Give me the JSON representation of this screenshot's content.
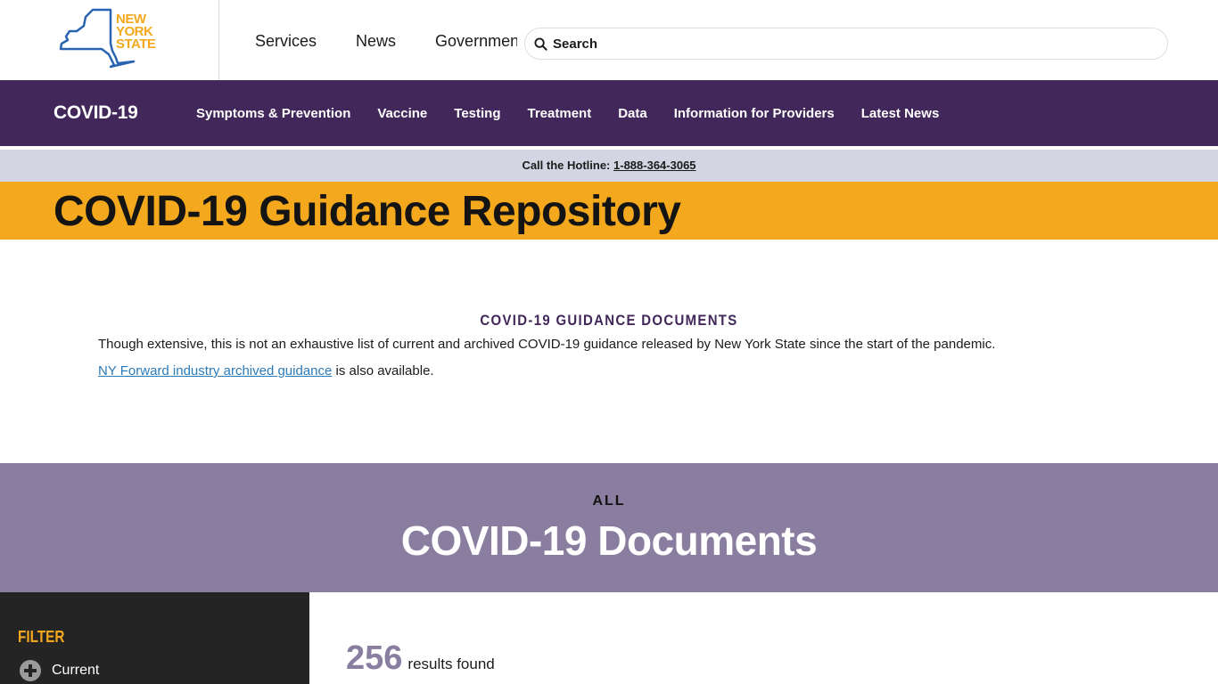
{
  "header": {
    "logo_lines": [
      "NEW",
      "YORK",
      "STATE"
    ],
    "nav": [
      "Services",
      "News",
      "Government"
    ],
    "search_placeholder": "Search"
  },
  "covid_nav": {
    "brand": "COVID-19",
    "links": [
      "Symptoms & Prevention",
      "Vaccine",
      "Testing",
      "Treatment",
      "Data",
      "Information for Providers",
      "Latest News"
    ]
  },
  "hotline": {
    "label": "Call the Hotline:",
    "number": "1-888-364-3065"
  },
  "page_title": "COVID-19 Guidance Repository",
  "intro": {
    "heading": "COVID-19 GUIDANCE DOCUMENTS",
    "paragraph": "Though extensive, this is not an exhaustive list of current and archived COVID-19 guidance released by New York State since the start of the pandemic.",
    "link_text": "NY Forward industry archived guidance",
    "link_suffix": " is also available."
  },
  "docs_banner": {
    "kicker": "ALL",
    "title": "COVID-19 Documents"
  },
  "filter": {
    "title": "FILTER",
    "items": [
      "Current"
    ]
  },
  "results": {
    "count": "256",
    "label": "results found"
  },
  "colors": {
    "purple": "#42275a",
    "gold": "#f4a81d",
    "banner_purple": "#897e9f",
    "hotline_bg": "#d3d5e2",
    "link_blue": "#2b7bb9",
    "dark_panel": "#242424"
  }
}
